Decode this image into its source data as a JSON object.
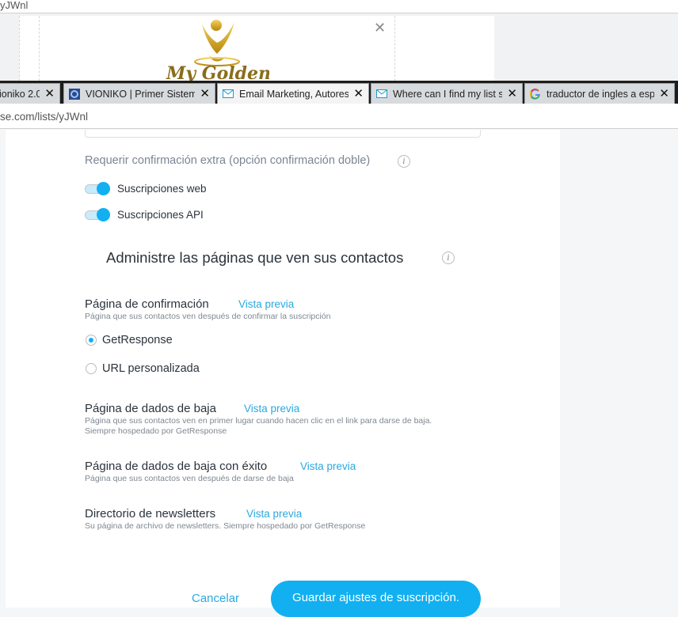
{
  "background_window": {
    "url_fragment": "yJWnl",
    "logo_text": "My Golden"
  },
  "tabs": [
    {
      "label": "ioniko 2.0",
      "close": "✕",
      "icon": "page-icon"
    },
    {
      "label": "VIONIKO | Primer Sistema",
      "close": "✕",
      "icon": "vioniko-favicon"
    },
    {
      "label": "Email Marketing, Autores",
      "close": "✕",
      "icon": "mail-icon",
      "active": true
    },
    {
      "label": "Where can I find my list s",
      "close": "✕",
      "icon": "mail-icon"
    },
    {
      "label": "traductor de ingles a espa",
      "close": "✕",
      "icon": "google-icon"
    }
  ],
  "address_bar": {
    "url": "se.com/lists/yJWnl"
  },
  "confirmation": {
    "label": "Requerir confirmación extra (opción confirmación doble)",
    "web": {
      "label": "Suscripciones web",
      "on": true
    },
    "api": {
      "label": "Suscripciones API",
      "on": true
    }
  },
  "pages_section": {
    "title": "Administre las páginas que ven sus contactos",
    "confirm_page": {
      "title": "Página de confirmación",
      "preview": "Vista previa",
      "desc": "Página que sus contactos ven después de confirmar la suscripción",
      "options": [
        "GetResponse",
        "URL personalizada"
      ],
      "selected": "GetResponse"
    },
    "unsub_page": {
      "title": "Página de dados de baja",
      "preview": "Vista previa",
      "desc1": "Página que sus contactos ven en primer lugar cuando hacen clic en el link para darse de baja.",
      "desc2": "Siempre hospedado por GetResponse"
    },
    "unsub_success": {
      "title": "Página de dados de baja con éxito",
      "preview": "Vista previa",
      "desc": "Página que sus contactos ven después de darse de baja"
    },
    "newsletter_dir": {
      "title": "Directorio de newsletters",
      "preview": "Vista previa",
      "desc": "Su página de archivo de newsletters. Siempre hospedado por GetResponse"
    }
  },
  "actions": {
    "cancel": "Cancelar",
    "save": "Guardar ajustes de suscripción."
  },
  "colors": {
    "accent": "#12b0f0",
    "link": "#2aa9e0",
    "tabbar": "#1d1d1d"
  }
}
